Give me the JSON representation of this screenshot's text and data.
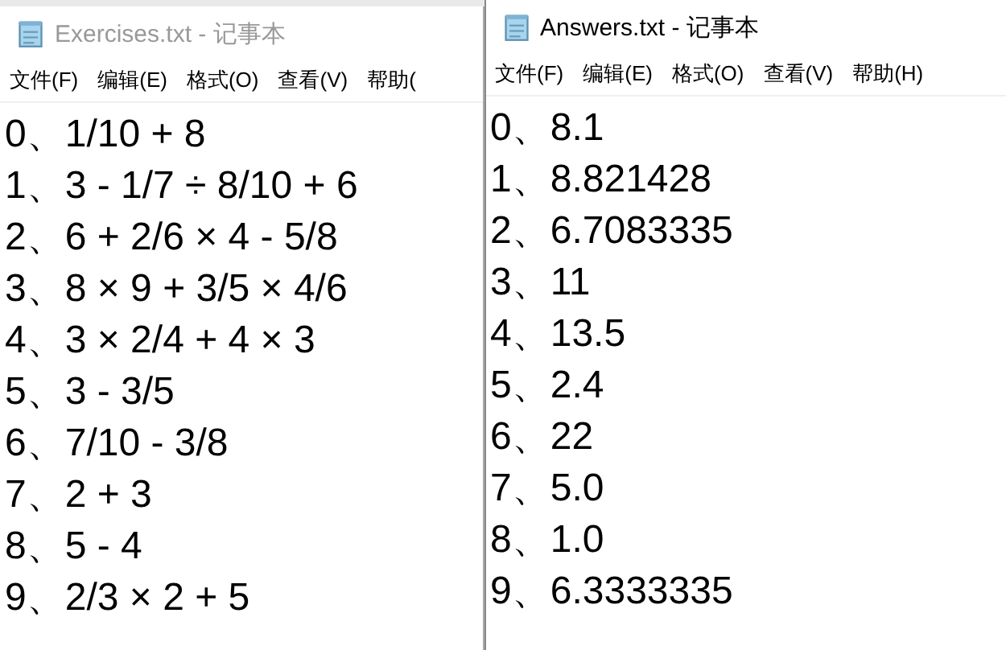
{
  "windows": [
    {
      "title": "Exercises.txt - 记事本",
      "active": false,
      "menu": [
        "文件(F)",
        "编辑(E)",
        "格式(O)",
        "查看(V)",
        "帮助("
      ],
      "lines": [
        "0、1/10 + 8",
        "1、3 - 1/7 ÷ 8/10 + 6",
        "2、6 + 2/6 × 4 - 5/8",
        "3、8 × 9 + 3/5 × 4/6",
        "4、3 × 2/4 + 4 × 3",
        "5、3 - 3/5",
        "6、7/10 - 3/8",
        "7、2 + 3",
        "8、5 - 4",
        "9、2/3 × 2 + 5"
      ]
    },
    {
      "title": "Answers.txt - 记事本",
      "active": true,
      "menu": [
        "文件(F)",
        "编辑(E)",
        "格式(O)",
        "查看(V)",
        "帮助(H)"
      ],
      "lines": [
        "0、8.1",
        "1、8.821428",
        "2、6.7083335",
        "3、11",
        "4、13.5",
        "5、2.4",
        "6、22",
        "7、5.0",
        "8、1.0",
        "9、6.3333335"
      ]
    }
  ]
}
